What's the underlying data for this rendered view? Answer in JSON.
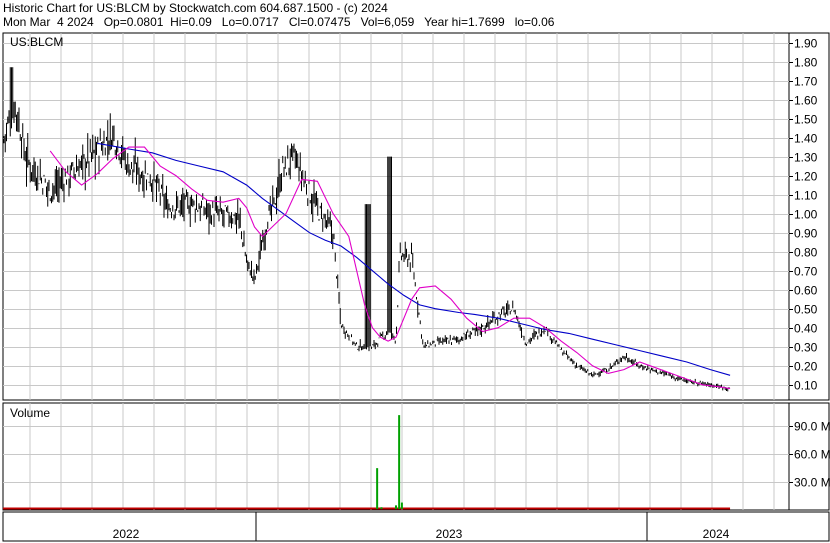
{
  "header": {
    "line1": "Historic Chart for US:BLCM by Stockwatch.com 604.687.1500 - (c) 2024",
    "line2": "Mon Mar  4 2024   Op=0.0801  Hi=0.09   Lo=0.0717   Cl=0.07475   Vol=6,059   Year hi=1.7699   lo=0.06"
  },
  "chart_data": [
    {
      "type": "line",
      "symbol_label": "US:BLCM",
      "style": "daily high-low bars with moving averages",
      "ylim": [
        0.02,
        1.95
      ],
      "y_ticks": [
        0.1,
        0.2,
        0.3,
        0.4,
        0.5,
        0.6,
        0.7,
        0.8,
        0.9,
        1.0,
        1.1,
        1.2,
        1.3,
        1.4,
        1.5,
        1.6,
        1.7,
        1.8,
        1.9
      ],
      "y_tick_labels": [
        "0.10",
        "0.20",
        "0.30",
        "0.40",
        "0.50",
        "0.60",
        "0.70",
        "0.80",
        "0.90",
        "1.00",
        "1.10",
        "1.20",
        "1.30",
        "1.40",
        "1.50",
        "1.60",
        "1.70",
        "1.80",
        "1.90"
      ],
      "x_labels": [
        "2022",
        "2023",
        "2024"
      ],
      "grid": true,
      "price_bars_color": "#000000",
      "series": [
        {
          "color": "#0000c8",
          "points": [
            [
              0.12,
              1.37
            ],
            [
              0.16,
              1.34
            ],
            [
              0.19,
              1.32
            ],
            [
              0.22,
              1.28
            ],
            [
              0.25,
              1.25
            ],
            [
              0.28,
              1.22
            ],
            [
              0.31,
              1.15
            ],
            [
              0.33,
              1.08
            ],
            [
              0.35,
              1.02
            ],
            [
              0.37,
              0.96
            ],
            [
              0.39,
              0.9
            ],
            [
              0.41,
              0.86
            ],
            [
              0.43,
              0.83
            ],
            [
              0.45,
              0.77
            ],
            [
              0.47,
              0.7
            ],
            [
              0.49,
              0.63
            ],
            [
              0.51,
              0.57
            ],
            [
              0.53,
              0.52
            ],
            [
              0.55,
              0.5
            ],
            [
              0.58,
              0.48
            ],
            [
              0.6,
              0.47
            ],
            [
              0.63,
              0.45
            ],
            [
              0.66,
              0.42
            ],
            [
              0.69,
              0.39
            ],
            [
              0.72,
              0.37
            ],
            [
              0.75,
              0.34
            ],
            [
              0.78,
              0.31
            ],
            [
              0.81,
              0.28
            ],
            [
              0.84,
              0.25
            ],
            [
              0.87,
              0.22
            ],
            [
              0.9,
              0.18
            ],
            [
              0.925,
              0.15
            ]
          ]
        },
        {
          "color": "#e000c8",
          "points": [
            [
              0.06,
              1.33
            ],
            [
              0.08,
              1.22
            ],
            [
              0.1,
              1.15
            ],
            [
              0.12,
              1.21
            ],
            [
              0.14,
              1.29
            ],
            [
              0.16,
              1.35
            ],
            [
              0.18,
              1.35
            ],
            [
              0.2,
              1.25
            ],
            [
              0.22,
              1.2
            ],
            [
              0.24,
              1.13
            ],
            [
              0.26,
              1.07
            ],
            [
              0.28,
              1.06
            ],
            [
              0.3,
              1.08
            ],
            [
              0.31,
              1.03
            ],
            [
              0.32,
              0.93
            ],
            [
              0.33,
              0.88
            ],
            [
              0.34,
              0.92
            ],
            [
              0.36,
              1.0
            ],
            [
              0.38,
              1.18
            ],
            [
              0.4,
              1.17
            ],
            [
              0.42,
              1.0
            ],
            [
              0.44,
              0.88
            ],
            [
              0.45,
              0.7
            ],
            [
              0.46,
              0.52
            ],
            [
              0.47,
              0.4
            ],
            [
              0.48,
              0.35
            ],
            [
              0.49,
              0.33
            ],
            [
              0.5,
              0.35
            ],
            [
              0.51,
              0.45
            ],
            [
              0.52,
              0.55
            ],
            [
              0.53,
              0.61
            ],
            [
              0.55,
              0.62
            ],
            [
              0.57,
              0.55
            ],
            [
              0.59,
              0.45
            ],
            [
              0.61,
              0.38
            ],
            [
              0.63,
              0.4
            ],
            [
              0.65,
              0.45
            ],
            [
              0.67,
              0.45
            ],
            [
              0.69,
              0.4
            ],
            [
              0.71,
              0.33
            ],
            [
              0.73,
              0.27
            ],
            [
              0.75,
              0.2
            ],
            [
              0.77,
              0.16
            ],
            [
              0.79,
              0.18
            ],
            [
              0.81,
              0.22
            ],
            [
              0.83,
              0.19
            ],
            [
              0.85,
              0.16
            ],
            [
              0.87,
              0.13
            ],
            [
              0.89,
              0.1
            ],
            [
              0.91,
              0.09
            ],
            [
              0.925,
              0.08
            ]
          ]
        }
      ]
    },
    {
      "type": "bar",
      "title": "Volume",
      "y_ticks": [
        30,
        60,
        90
      ],
      "y_tick_labels": [
        "30.0 M",
        "60.0 M",
        "90.0 M"
      ],
      "ylim": [
        0,
        115
      ],
      "bar_color": "#00a000",
      "baseline_color": "#c00000",
      "spikes": [
        [
          0.476,
          45
        ],
        [
          0.4815,
          3
        ],
        [
          0.5,
          5
        ],
        [
          0.504,
          102
        ],
        [
          0.5075,
          8
        ]
      ]
    }
  ]
}
